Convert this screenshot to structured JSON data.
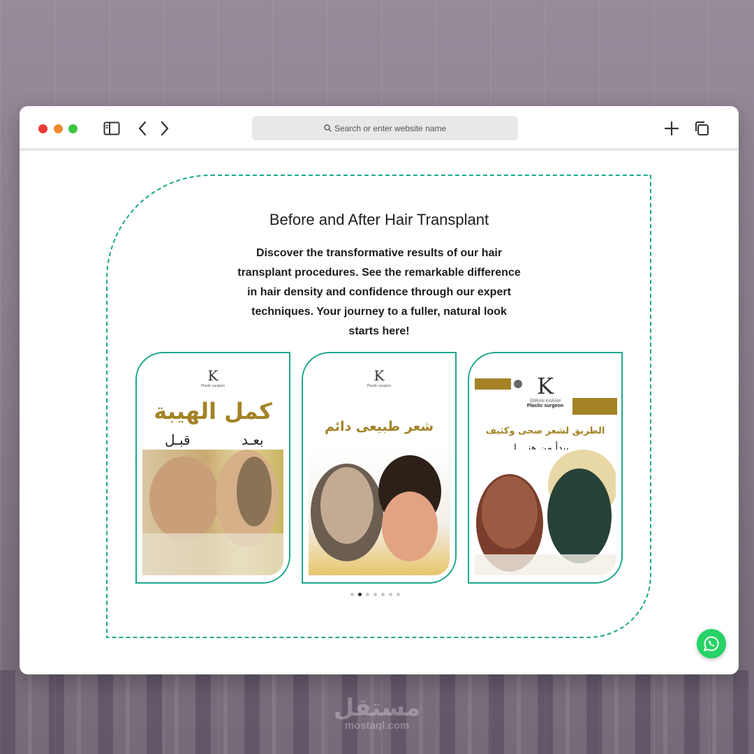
{
  "browser": {
    "search_placeholder": "Search or enter website name"
  },
  "section": {
    "title": "Before and After Hair Transplant",
    "description": "Discover the transformative results of our hair transplant procedures. See the remarkable difference in hair density and confidence through our expert techniques. Your journey to a fuller, natural look starts here!"
  },
  "cards": [
    {
      "headline": "كمل الهيبة",
      "label_after": "بعـد",
      "label_before": "قبـل",
      "logo_sub": "Plastic surgeon"
    },
    {
      "headline": "شعر طبيعى دائم",
      "logo_sub": "Plastic surgeon"
    },
    {
      "headline": "الطريق لشعر صحى وكثيف",
      "subline": "يبدأ من هنــــا",
      "logo_name": "EBRAN KARAM",
      "logo_sub": "Plastic surgeon"
    }
  ],
  "carousel": {
    "dot_count": 7,
    "active_index": 1
  },
  "watermark": {
    "arabic": "مستقل",
    "latin": "mostaql.com"
  },
  "colors": {
    "accent_teal": "#1ea88c",
    "gold": "#a38326",
    "whatsapp_green": "#25d366"
  },
  "icons": [
    "sidebar-icon",
    "back-chevron-icon",
    "forward-chevron-icon",
    "search-icon",
    "plus-icon",
    "tabs-icon",
    "whatsapp-icon"
  ]
}
